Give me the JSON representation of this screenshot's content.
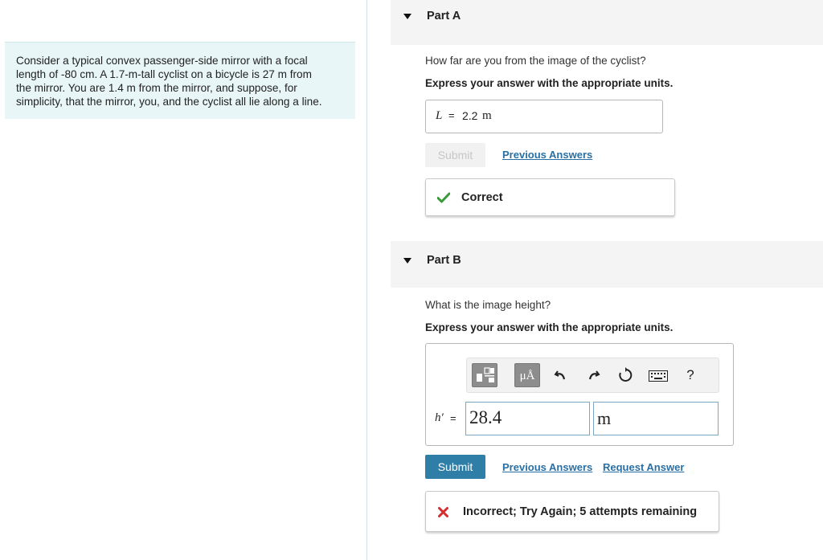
{
  "problem": {
    "text_1": "Consider a typical convex passenger-side mirror with a focal",
    "text_2": "length of -80 cm. A 1.7-m-tall cyclist on a bicycle is 27 m from",
    "text_3": "the mirror. You are 1.4 m from the mirror, and suppose, for",
    "text_4": "simplicity, that the mirror, you, and the cyclist all lie along a line."
  },
  "part_a": {
    "title": "Part A",
    "question": "How far are you from the image of the cyclist?",
    "instruction": "Express your answer with the appropriate units.",
    "answer_var": "L",
    "answer_eq": "=",
    "answer_value": "2.2",
    "answer_unit": "m",
    "submit_label": "Submit",
    "previous_answers_label": "Previous Answers",
    "feedback": "Correct"
  },
  "part_b": {
    "title": "Part B",
    "question": "What is the image height?",
    "instruction": "Express your answer with the appropriate units.",
    "toolbar": {
      "units_label": "μÅ",
      "help_label": "?"
    },
    "answer_var": "h′",
    "answer_eq": "=",
    "answer_value": "28.4",
    "answer_unit": "m",
    "submit_label": "Submit",
    "previous_answers_label": "Previous Answers",
    "request_answer_label": "Request Answer",
    "feedback": "Incorrect; Try Again; 5 attempts remaining"
  },
  "colors": {
    "accent": "#2f7ea8",
    "link": "#2a6fa3",
    "correct": "#3a9a3a",
    "incorrect": "#d32f2f",
    "problem_bg": "#e8f6f7"
  }
}
